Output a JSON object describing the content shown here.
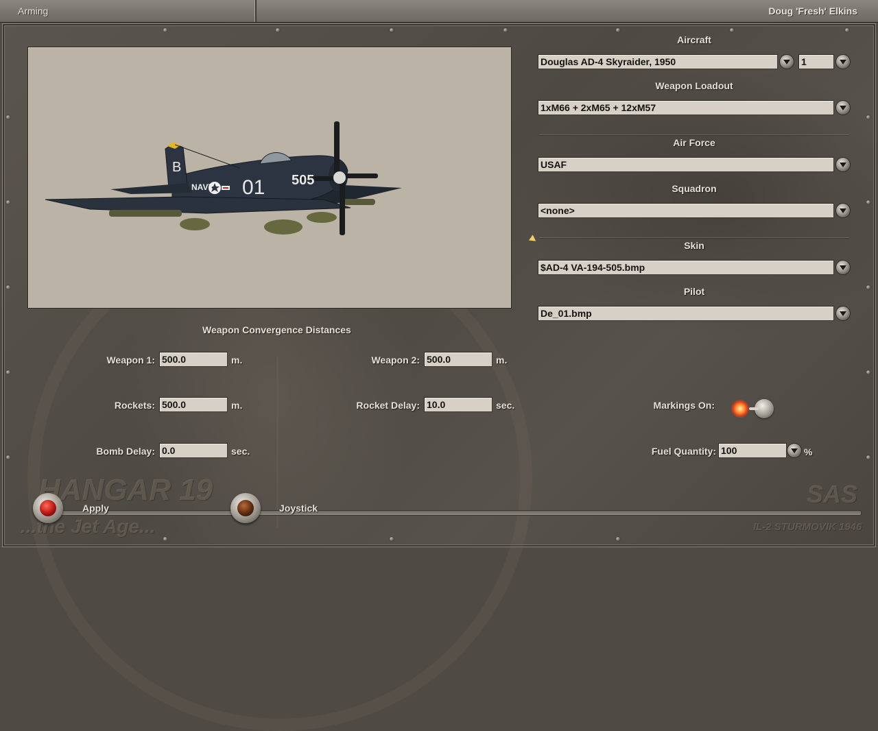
{
  "topbar": {
    "title": "Arming",
    "pilot_name": "Doug 'Fresh' Elkins"
  },
  "aircraft_section": {
    "label": "Aircraft",
    "value": "Douglas AD-4 Skyraider, 1950",
    "count": "1"
  },
  "loadout_section": {
    "label": "Weapon Loadout",
    "value": "1xM66 + 2xM65 + 12xM57"
  },
  "air_force_section": {
    "label": "Air Force",
    "value": "USAF"
  },
  "squadron_section": {
    "label": "Squadron",
    "value": "<none>"
  },
  "skin_section": {
    "label": "Skin",
    "value": "$AD-4 VA-194-505.bmp"
  },
  "pilot_section": {
    "label": "Pilot",
    "value": "De_01.bmp"
  },
  "convergence": {
    "title": "Weapon Convergence Distances",
    "weapon1_label": "Weapon 1:",
    "weapon1_value": "500.0",
    "weapon1_unit": "m.",
    "weapon2_label": "Weapon 2:",
    "weapon2_value": "500.0",
    "weapon2_unit": "m.",
    "rockets_label": "Rockets:",
    "rockets_value": "500.0",
    "rockets_unit": "m.",
    "rocket_delay_label": "Rocket Delay:",
    "rocket_delay_value": "10.0",
    "rocket_delay_unit": "sec.",
    "bomb_delay_label": "Bomb Delay:",
    "bomb_delay_value": "0.0",
    "bomb_delay_unit": "sec."
  },
  "options": {
    "markings_label": "Markings On:",
    "markings_on": true,
    "fuel_label": "Fuel Quantity:",
    "fuel_value": "100",
    "fuel_unit": "%"
  },
  "buttons": {
    "apply_label": "Apply",
    "joystick_label": "Joystick"
  },
  "aircraft_markings": {
    "tail_letter": "B",
    "fuselage_number": "01",
    "nose_number": "505",
    "service_text": "NAVY"
  },
  "watermarks": {
    "hangar": "HANGAR 19",
    "tagline": "...the Jet Age...",
    "sas": "SAS",
    "game": "IL-2 STURMOVIK 1946"
  },
  "colors": {
    "panel_bg": "#4f4a43",
    "preview_bg": "#bcb3a7",
    "field_bg": "#d6d0c6",
    "label_text": "#e4e0d8",
    "aircraft_body": "#2b3440"
  }
}
